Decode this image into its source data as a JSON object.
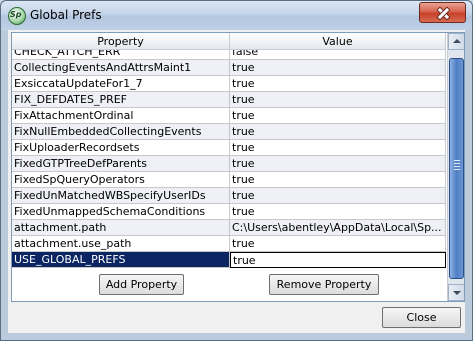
{
  "window": {
    "title": "Global Prefs",
    "app_icon": "Sp"
  },
  "table": {
    "headers": {
      "property": "Property",
      "value": "Value"
    },
    "rows": [
      {
        "property": "CHECK_ATTCH_ERR",
        "value": "false"
      },
      {
        "property": "CollectingEventsAndAttrsMaint1",
        "value": "true"
      },
      {
        "property": "ExsiccataUpdateFor1_7",
        "value": "true"
      },
      {
        "property": "FIX_DEFDATES_PREF",
        "value": "true"
      },
      {
        "property": "FixAttachmentOrdinal",
        "value": "true"
      },
      {
        "property": "FixNullEmbeddedCollectingEvents",
        "value": "true"
      },
      {
        "property": "FixUploaderRecordsets",
        "value": "true"
      },
      {
        "property": "FixedGTPTreeDefParents",
        "value": "true"
      },
      {
        "property": "FixedSpQueryOperators",
        "value": "true"
      },
      {
        "property": "FixedUnMatchedWBSpecifyUserIDs",
        "value": "true"
      },
      {
        "property": "FixedUnmappedSchemaConditions",
        "value": "true"
      },
      {
        "property": "attachment.path",
        "value": "C:\\Users\\abentley\\AppData\\Local\\Sp..."
      },
      {
        "property": "attachment.use_path",
        "value": "true"
      },
      {
        "property": "USE_GLOBAL_PREFS",
        "value": "true"
      }
    ],
    "selected_index": 13
  },
  "buttons": {
    "add_property": "Add Property",
    "remove_property": "Remove Property",
    "close": "Close"
  }
}
